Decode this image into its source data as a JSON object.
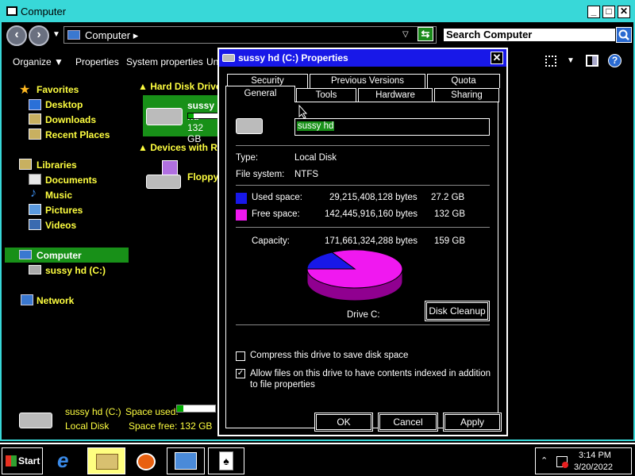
{
  "explorer": {
    "title": "Computer",
    "address": "Computer ▸",
    "search_placeholder": "Search Computer",
    "toolbar": {
      "organize": "Organize",
      "properties": "Properties",
      "system_properties": "System properties",
      "uninstall_partial": "Un"
    },
    "nav": {
      "favorites": "Favorites",
      "desktop": "Desktop",
      "downloads": "Downloads",
      "recent_places": "Recent Places",
      "libraries": "Libraries",
      "documents": "Documents",
      "music": "Music",
      "pictures": "Pictures",
      "videos": "Videos",
      "computer": "Computer",
      "drive_c": "sussy hd (C:)",
      "network": "Network"
    },
    "content": {
      "hard_disk_group": "Hard Disk Drive",
      "drive_name": "sussy hd",
      "drive_free": "132 GB",
      "drive_used_fraction": 0.17,
      "removable_group": "Devices with Re",
      "floppy": "Floppy"
    },
    "details": {
      "name": "sussy hd (C:)",
      "type": "Local Disk",
      "space_used_label": "Space used:",
      "space_free_label": "Space free:",
      "space_free": "132 GB",
      "used_fraction": 0.17
    }
  },
  "dialog": {
    "title": "sussy hd (C:) Properties",
    "tabs_top": [
      "Security",
      "Previous Versions",
      "Quota"
    ],
    "tabs_bottom": [
      "General",
      "Tools",
      "Hardware",
      "Sharing"
    ],
    "drive_label": "sussy hd",
    "type_label": "Type:",
    "type_value": "Local Disk",
    "fs_label": "File system:",
    "fs_value": "NTFS",
    "used_label": "Used space:",
    "used_bytes": "29,215,408,128 bytes",
    "used_gb": "27.2 GB",
    "free_label": "Free space:",
    "free_bytes": "142,445,916,160 bytes",
    "free_gb": "132 GB",
    "capacity_label": "Capacity:",
    "capacity_bytes": "171,661,324,288 bytes",
    "capacity_gb": "159 GB",
    "drive_caption": "Drive C:",
    "disk_cleanup": "Disk Cleanup",
    "compress_label": "Compress this drive to save disk space",
    "compress_checked": false,
    "index_label": "Allow files on this drive to have contents indexed in addition to file properties",
    "index_checked": true,
    "ok": "OK",
    "cancel": "Cancel",
    "apply": "Apply",
    "used_color": "#1818e8",
    "free_color": "#f018f0"
  },
  "taskbar": {
    "start": "Start",
    "time": "3:14 PM",
    "date": "3/20/2022"
  }
}
